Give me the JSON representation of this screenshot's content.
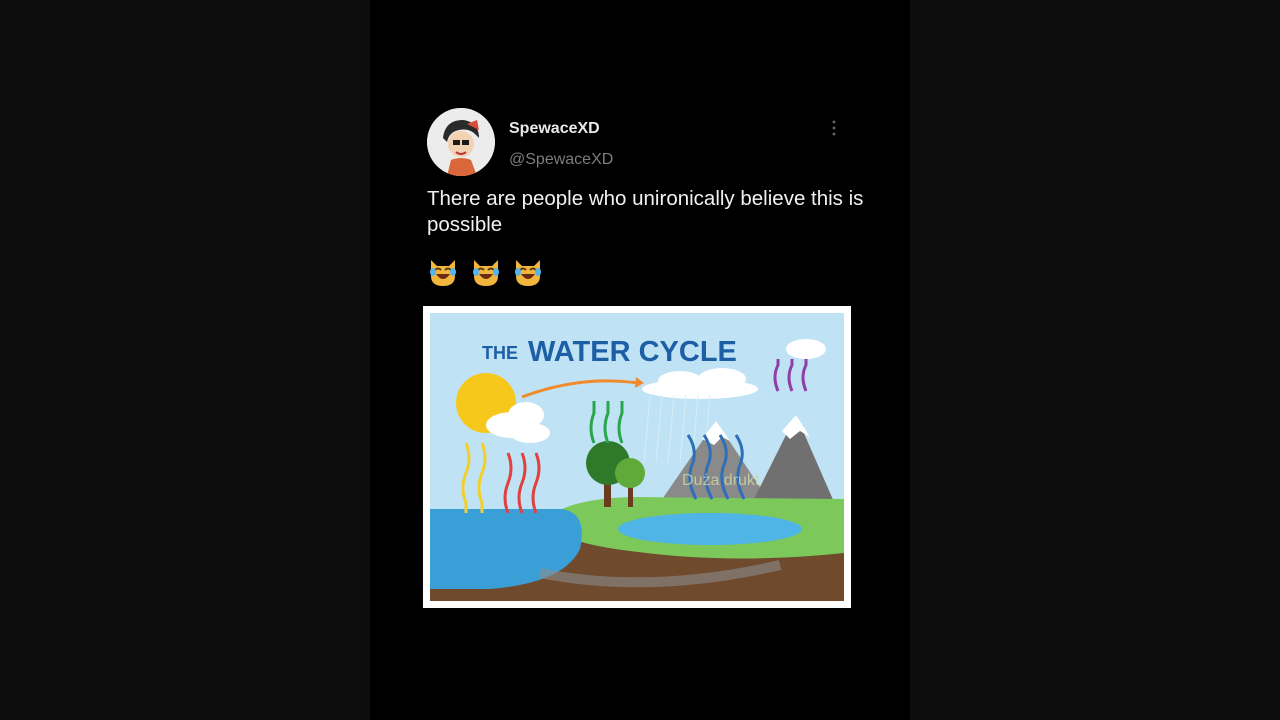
{
  "tweet": {
    "display_name": "SpewaceXD",
    "handle": "@SpewaceXD",
    "text": "There are people who unironically believe this is possible",
    "emoji": "😹😹😹",
    "more_icon": "more-vertical-icon"
  },
  "image": {
    "title_small": "THE",
    "title_large": "WATER CYCLE",
    "watermark": "Duża drukt"
  },
  "colors": {
    "background": "#000000",
    "sky": "#bde2f3",
    "water": "#3a9fd6",
    "title": "#1d5fa5"
  }
}
